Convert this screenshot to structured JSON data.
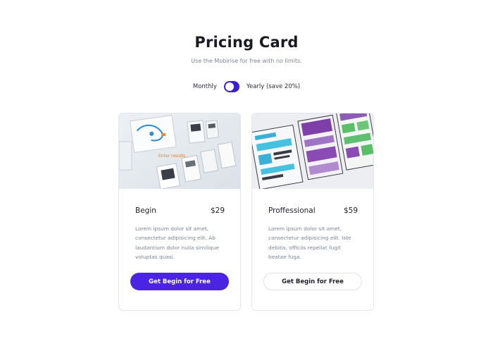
{
  "header": {
    "title": "Pricing Card",
    "subtitle": "Use the Mobirise for free with no limits."
  },
  "billing_toggle": {
    "left_label": "Monthly",
    "right_label": "Yearly (save 20%)"
  },
  "plans": [
    {
      "name": "Begin",
      "price": "$29",
      "description": "Lorem ipsum dolor sit amet, consectetur adipisicing elit. Ab laudantium dolor nulla similique voluptas quasi.",
      "button_label": "Get Begin for Free"
    },
    {
      "name": "Proffessional",
      "price": "$59",
      "description": "Lorem ipsum dolor sit amet, consectetur adipisicing elit. Iste debitis, officiis repellat fugit beatae fuga.",
      "button_label": "Get Begin for Free"
    }
  ],
  "colors": {
    "accent": "#4a24e0",
    "toggle": "#3b1fd6"
  }
}
